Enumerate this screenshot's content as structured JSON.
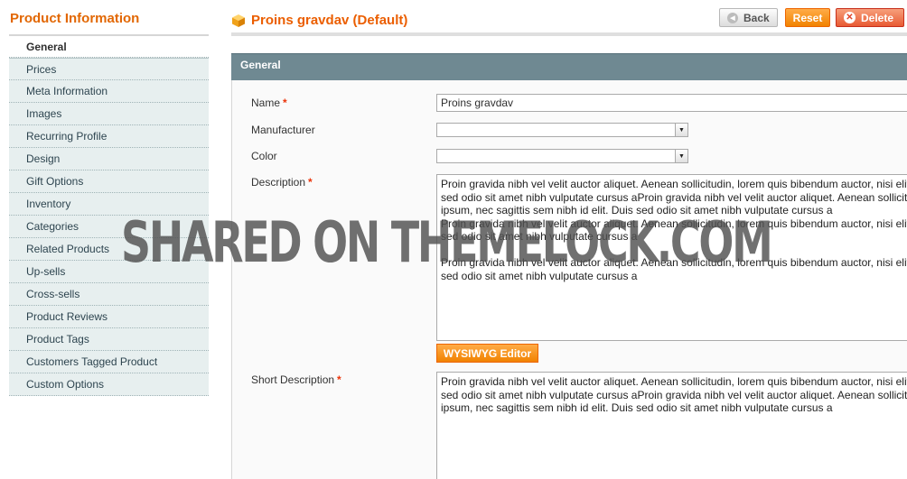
{
  "sidebar": {
    "title": "Product Information",
    "tabs": [
      {
        "label": "General",
        "active": true
      },
      {
        "label": "Prices"
      },
      {
        "label": "Meta Information"
      },
      {
        "label": "Images"
      },
      {
        "label": "Recurring Profile"
      },
      {
        "label": "Design"
      },
      {
        "label": "Gift Options"
      },
      {
        "label": "Inventory"
      },
      {
        "label": "Categories"
      },
      {
        "label": "Related Products"
      },
      {
        "label": "Up-sells"
      },
      {
        "label": "Cross-sells"
      },
      {
        "label": "Product Reviews"
      },
      {
        "label": "Product Tags"
      },
      {
        "label": "Customers Tagged Product"
      },
      {
        "label": "Custom Options"
      }
    ]
  },
  "header": {
    "title": "Proins gravdav (Default)",
    "back_label": "Back",
    "reset_label": "Reset",
    "delete_label": "Delete"
  },
  "section": {
    "title": "General"
  },
  "form": {
    "name": {
      "label": "Name",
      "required": "*",
      "value": "Proins gravdav"
    },
    "manufacturer": {
      "label": "Manufacturer",
      "value": ""
    },
    "color": {
      "label": "Color",
      "value": ""
    },
    "description": {
      "label": "Description",
      "required": "*",
      "value": "Proin gravida nibh vel velit auctor aliquet. Aenean sollicitudin, lorem quis bibendum auctor, nisi elit\nsed odio sit amet nibh vulputate cursus aProin gravida nibh vel velit auctor aliquet. Aenean sollicitu\nipsum, nec sagittis sem nibh id elit. Duis sed odio sit amet nibh vulputate cursus a\nProin gravida nibh vel velit auctor aliquet. Aenean sollicitudin, lorem quis bibendum auctor, nisi elit\nsed odio sit amet nibh vulputate cursus a\n\nProin gravida nibh vel velit auctor aliquet. Aenean sollicitudin, lorem quis bibendum auctor, nisi elit\nsed odio sit amet nibh vulputate cursus a"
    },
    "wysiwyg_label": "WYSIWYG Editor",
    "short_description": {
      "label": "Short Description",
      "required": "*",
      "value": "Proin gravida nibh vel velit auctor aliquet. Aenean sollicitudin, lorem quis bibendum auctor, nisi elit\nsed odio sit amet nibh vulputate cursus aProin gravida nibh vel velit auctor aliquet. Aenean sollicitu\nipsum, nec sagittis sem nibh id elit. Duis sed odio sit amet nibh vulputate cursus a"
    }
  },
  "watermark": "SHARED ON THEMELOCK.COM",
  "icons": {
    "title": "cube-icon",
    "back": "back-arrow-icon",
    "delete": "delete-x-icon",
    "select": "chevron-down-icon"
  },
  "colors": {
    "accent": "#eb5e00",
    "section": "#6f8992",
    "tab_bg": "#e7efef"
  }
}
